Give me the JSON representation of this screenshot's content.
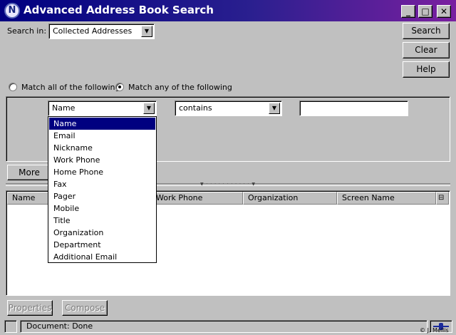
{
  "window": {
    "title": "Advanced Address Book Search",
    "app_icon_letter": "N",
    "minimize_glyph": "_",
    "maximize_glyph": "□",
    "close_glyph": "✕"
  },
  "search_in": {
    "label": "Search in:",
    "value": "Collected Addresses"
  },
  "buttons": {
    "search": "Search",
    "clear": "Clear",
    "help": "Help",
    "more": "More",
    "properties": "Properties",
    "compose": "Compose"
  },
  "match": {
    "all_label": "Match all of the following",
    "any_label": "Match any of the following",
    "selected": "any"
  },
  "criteria": {
    "field": "Name",
    "operator": "contains",
    "value": ""
  },
  "field_options": [
    "Name",
    "Email",
    "Nickname",
    "Work Phone",
    "Home Phone",
    "Fax",
    "Pager",
    "Mobile",
    "Title",
    "Organization",
    "Department",
    "Additional Email"
  ],
  "results": {
    "columns": [
      "Name",
      "Work Phone",
      "Organization",
      "Screen Name"
    ]
  },
  "status": {
    "text": "Document: Done",
    "copyright": "© J. Mellis"
  },
  "icons": {
    "app": "netscape-n-icon",
    "dropdown": "chevron-down-icon",
    "column_picker": "column-picker-icon",
    "offline": "online-status-icon"
  }
}
